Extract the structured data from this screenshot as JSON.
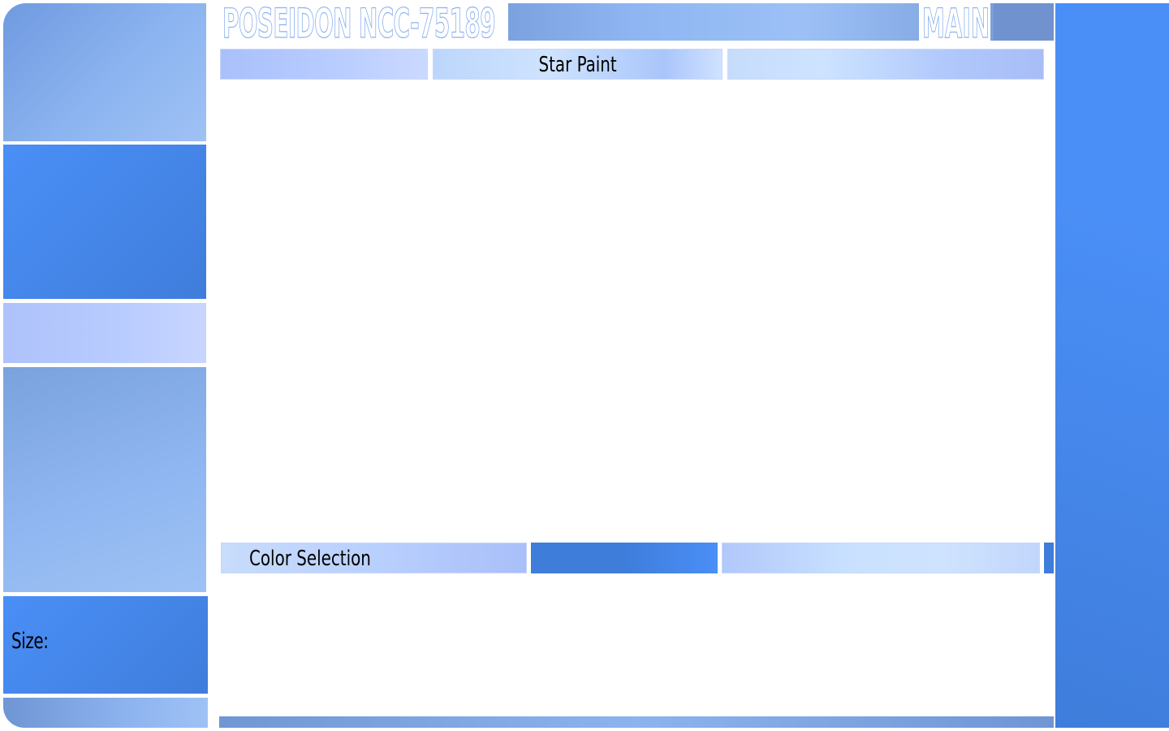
{
  "header": {
    "ship_name": "POSEIDON   NCC-75189",
    "section": "MAIN"
  },
  "canvas_panel": {
    "title": "Star Paint"
  },
  "color_panel": {
    "title": "Color Selection"
  },
  "sidebar": {
    "size_label": "Size:"
  },
  "colors": {
    "light_blue": "#8cb4f0",
    "bright_blue": "#4a8ff7",
    "deep_blue": "#3f7ddb",
    "lavender": "#b9ccff",
    "steel_blue": "#7092cf",
    "background": "#ffffff"
  }
}
